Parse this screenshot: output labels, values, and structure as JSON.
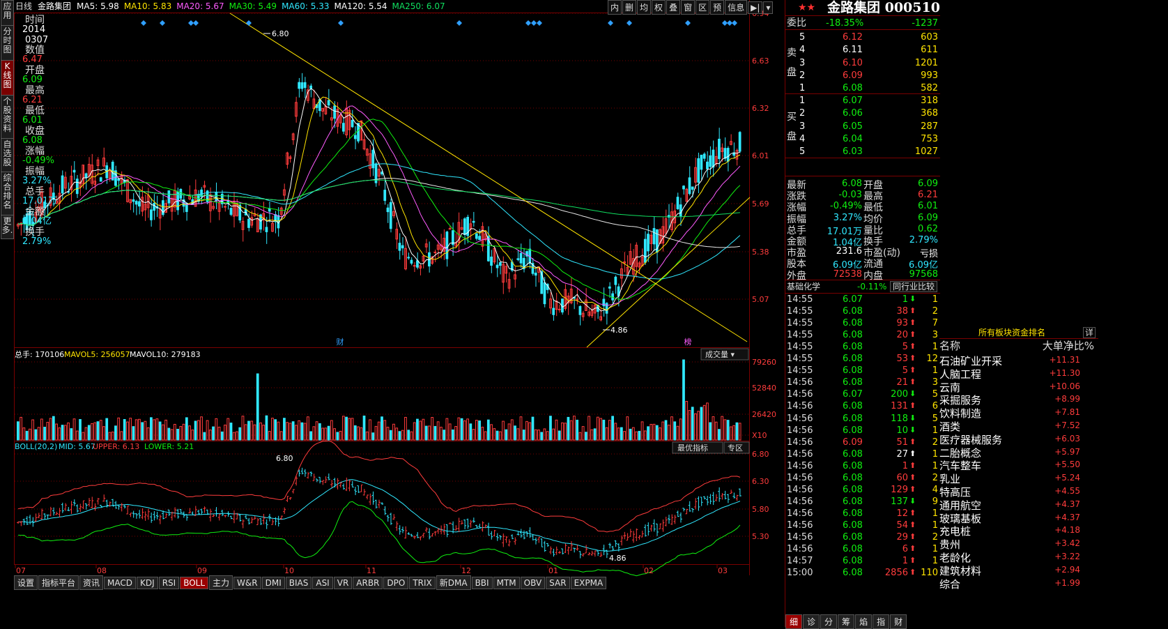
{
  "sidebar": {
    "tabs": [
      "应用",
      "分时图",
      "K线图",
      "个股资料",
      "自选股",
      "综合排名",
      "更多."
    ],
    "active": 2
  },
  "chart_header": {
    "period": "日线",
    "stock_name": "金路集团",
    "ma": [
      {
        "label": "MA5:",
        "value": "5.98",
        "color": "#ffffff"
      },
      {
        "label": "MA10:",
        "value": "5.83",
        "color": "#ffe400"
      },
      {
        "label": "MA20:",
        "value": "5.67",
        "color": "#ff5cff"
      },
      {
        "label": "MA30:",
        "value": "5.49",
        "color": "#10f010"
      },
      {
        "label": "MA60:",
        "value": "5.33",
        "color": "#30e8ff"
      },
      {
        "label": "MA120:",
        "value": "5.54",
        "color": "#ffffff"
      },
      {
        "label": "MA250:",
        "value": "6.07",
        "color": "#10e060"
      }
    ]
  },
  "toolbar": [
    "内",
    "删",
    "均",
    "权",
    "叠",
    "窗",
    "区",
    "预",
    "信息",
    "▶|",
    "▾"
  ],
  "info_panel": [
    {
      "label": "时间",
      "value": "2014"
    },
    {
      "label": "",
      "value": "0307"
    },
    {
      "label": "数值",
      "value": "6.47",
      "color": "red"
    },
    {
      "label": "开盘",
      "value": "6.09",
      "color": "green"
    },
    {
      "label": "最高",
      "value": "6.21",
      "color": "red"
    },
    {
      "label": "最低",
      "value": "6.01",
      "color": "green"
    },
    {
      "label": "收盘",
      "value": "6.08",
      "color": "green"
    },
    {
      "label": "涨幅",
      "value": "-0.49%",
      "color": "green"
    },
    {
      "label": "振幅",
      "value": "3.27%",
      "color": "cyan"
    },
    {
      "label": "总手",
      "value": "17.01万",
      "color": "cyan"
    },
    {
      "label": "金额",
      "value": "1.04亿",
      "color": "cyan"
    },
    {
      "label": "换手",
      "value": "2.79%",
      "color": "cyan"
    }
  ],
  "price_axis": [
    "6.94",
    "6.63",
    "6.32",
    "6.01",
    "5.69",
    "5.38",
    "5.07"
  ],
  "price_annotations": {
    "high": "6.80",
    "low": "4.86"
  },
  "event_labels": {
    "cai": "财",
    "bang": "榜"
  },
  "volume_header": {
    "label": "总手:",
    "value": "170106",
    "mavol5_label": "MAVOL5:",
    "mavol5": "256057",
    "mavol10_label": "MAVOL10:",
    "mavol10": "279183",
    "selector": "成交量 ▾"
  },
  "volume_axis": [
    "79260",
    "52840",
    "26420",
    "X10"
  ],
  "boll_header": {
    "label": "BOLL(20,2)",
    "mid_label": "MID:",
    "mid": "5.67",
    "upper_label": "UPPER:",
    "upper": "6.13",
    "lower_label": "LOWER:",
    "lower": "5.21",
    "btn1": "最优指标",
    "btn2": "专区"
  },
  "boll_axis": [
    "6.80",
    "6.30",
    "5.80",
    "5.30"
  ],
  "boll_annotations": {
    "high": "6.80",
    "low": "4.86"
  },
  "date_axis": [
    "07",
    "08",
    "09",
    "10",
    "11",
    "12",
    "01",
    "02",
    "03"
  ],
  "bottom_tabs": [
    "设置",
    "指标平台",
    "资讯",
    "MACD",
    "KDJ",
    "RSI",
    "BOLL",
    "主力",
    "W&R",
    "DMI",
    "BIAS",
    "ASI",
    "VR",
    "ARBR",
    "DPO",
    "TRIX",
    "新DMA",
    "BBI",
    "MTM",
    "OBV",
    "SAR",
    "EXPMA"
  ],
  "bottom_active": 6,
  "quote": {
    "title": "金路集团 000510",
    "weibi_label": "委比",
    "weibi": "-18.35%",
    "weicha": "-1237",
    "sell_label": "卖盘",
    "buy_label": "买盘",
    "sells": [
      [
        "5",
        "6.12",
        "603",
        "red"
      ],
      [
        "4",
        "6.11",
        "611",
        "white"
      ],
      [
        "3",
        "6.10",
        "1201",
        "red"
      ],
      [
        "2",
        "6.09",
        "993",
        "red"
      ],
      [
        "1",
        "6.08",
        "582",
        "green"
      ]
    ],
    "buys": [
      [
        "1",
        "6.07",
        "318",
        "green"
      ],
      [
        "2",
        "6.06",
        "368",
        "green"
      ],
      [
        "3",
        "6.05",
        "287",
        "green"
      ],
      [
        "4",
        "6.04",
        "753",
        "green"
      ],
      [
        "5",
        "6.03",
        "1027",
        "green"
      ]
    ]
  },
  "stats": [
    [
      "最新",
      "6.08",
      "green",
      "开盘",
      "6.09",
      "green"
    ],
    [
      "涨跌",
      "-0.03",
      "green",
      "最高",
      "6.21",
      "red"
    ],
    [
      "涨幅",
      "-0.49%",
      "green",
      "最低",
      "6.01",
      "green"
    ],
    [
      "振幅",
      "3.27%",
      "cyan",
      "均价",
      "6.09",
      "green"
    ],
    [
      "总手",
      "17.01万",
      "cyan",
      "量比",
      "0.62",
      "green"
    ],
    [
      "金额",
      "1.04亿",
      "cyan",
      "换手",
      "2.79%",
      "cyan"
    ],
    [
      "市盈",
      "231.6",
      "white",
      "市盈(动)",
      "亏损",
      "white"
    ],
    [
      "股本",
      "6.09亿",
      "cyan",
      "流通",
      "6.09亿",
      "cyan"
    ],
    [
      "外盘",
      "72538",
      "red",
      "内盘",
      "97568",
      "green"
    ]
  ],
  "basic_chem": {
    "label": "基础化学",
    "value": "-0.11%",
    "peer": "同行业比较"
  },
  "ticks": [
    [
      "14:55",
      "6.07",
      "1",
      "down",
      "1"
    ],
    [
      "14:55",
      "6.08",
      "38",
      "up",
      "2"
    ],
    [
      "14:55",
      "6.08",
      "93",
      "up",
      "7"
    ],
    [
      "14:55",
      "6.08",
      "20",
      "up",
      "3"
    ],
    [
      "14:55",
      "6.08",
      "5",
      "up",
      "1"
    ],
    [
      "14:55",
      "6.08",
      "53",
      "up",
      "12"
    ],
    [
      "14:55",
      "6.08",
      "5",
      "up",
      "1"
    ],
    [
      "14:56",
      "6.08",
      "21",
      "up",
      "3"
    ],
    [
      "14:56",
      "6.07",
      "200",
      "down",
      "5"
    ],
    [
      "14:56",
      "6.08",
      "131",
      "up",
      "6"
    ],
    [
      "14:56",
      "6.08",
      "118",
      "down",
      "5"
    ],
    [
      "14:56",
      "6.08",
      "10",
      "down",
      "1"
    ],
    [
      "14:56",
      "6.09",
      "51",
      "up",
      "2"
    ],
    [
      "14:56",
      "6.08",
      "27",
      "upw",
      "1"
    ],
    [
      "14:56",
      "6.08",
      "1",
      "up",
      "1"
    ],
    [
      "14:56",
      "6.08",
      "60",
      "up",
      "2"
    ],
    [
      "14:56",
      "6.08",
      "129",
      "up",
      "4"
    ],
    [
      "14:56",
      "6.08",
      "137",
      "down",
      "9"
    ],
    [
      "14:56",
      "6.08",
      "12",
      "up",
      "1"
    ],
    [
      "14:56",
      "6.08",
      "54",
      "up",
      "1"
    ],
    [
      "14:56",
      "6.08",
      "29",
      "up",
      "2"
    ],
    [
      "14:56",
      "6.08",
      "6",
      "up",
      "1"
    ],
    [
      "14:57",
      "6.08",
      "1",
      "up",
      "1"
    ],
    [
      "15:00",
      "6.08",
      "2856",
      "up",
      "110"
    ]
  ],
  "sector": {
    "title": "所有板块资金排名",
    "detail": "详",
    "col1": "名称",
    "col2": "大单净比%",
    "rows": [
      [
        "石油矿业开采",
        "+11.31"
      ],
      [
        "人脑工程",
        "+11.30"
      ],
      [
        "云南",
        "+10.06"
      ],
      [
        "采掘服务",
        "+8.99"
      ],
      [
        "饮料制造",
        "+7.81"
      ],
      [
        "酒类",
        "+7.52"
      ],
      [
        "医疗器械服务",
        "+6.03"
      ],
      [
        "二胎概念",
        "+5.97"
      ],
      [
        "汽车整车",
        "+5.50"
      ],
      [
        "乳业",
        "+5.24"
      ],
      [
        "特高压",
        "+4.55"
      ],
      [
        "通用航空",
        "+4.37"
      ],
      [
        "玻璃基板",
        "+4.37"
      ],
      [
        "充电桩",
        "+4.18"
      ],
      [
        "贵州",
        "+3.42"
      ],
      [
        "老龄化",
        "+3.22"
      ],
      [
        "建筑材料",
        "+2.94"
      ],
      [
        "综合",
        "+1.99"
      ]
    ]
  },
  "right_tabs": [
    "细",
    "诊",
    "分",
    "筹",
    "焰",
    "指",
    "财"
  ],
  "right_active": 0
}
